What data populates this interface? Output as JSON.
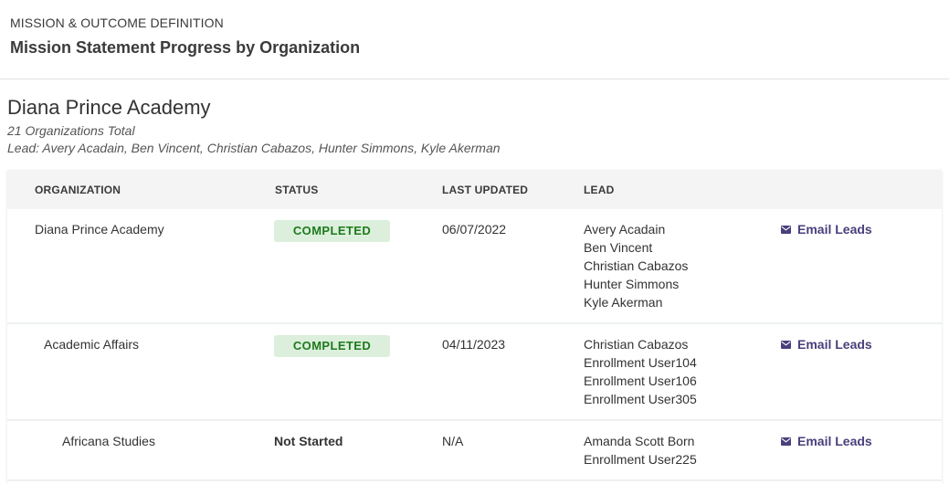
{
  "header": {
    "eyebrow": "MISSION & OUTCOME DEFINITION",
    "title": "Mission Statement Progress by Organization"
  },
  "organization": {
    "name": "Diana Prince Academy",
    "total": "21 Organizations Total",
    "leads": "Lead: Avery Acadain, Ben Vincent, Christian Cabazos, Hunter Simmons, Kyle Akerman"
  },
  "table": {
    "columns": [
      "ORGANIZATION",
      "STATUS",
      "LAST UPDATED",
      "LEAD"
    ],
    "rows": [
      {
        "organization": "Diana Prince Academy",
        "status": "COMPLETED",
        "last_updated": "06/07/2022",
        "leads": [
          "Avery Acadain",
          "Ben Vincent",
          "Christian Cabazos",
          "Hunter Simmons",
          "Kyle Akerman"
        ],
        "action": "Email Leads"
      },
      {
        "organization": "Academic Affairs",
        "status": "COMPLETED",
        "last_updated": "04/11/2023",
        "leads": [
          "Christian Cabazos",
          "Enrollment User104",
          "Enrollment User106",
          "Enrollment User305"
        ],
        "action": "Email Leads"
      },
      {
        "organization": "Africana Studies",
        "status": "Not Started",
        "last_updated": "N/A",
        "leads": [
          "Amanda Scott Born",
          "Enrollment User225"
        ],
        "action": "Email Leads"
      }
    ]
  },
  "colors": {
    "completed_badge_bg": "#dcefdc",
    "completed_badge_text": "#1e7a1e",
    "link": "#4a3f7c"
  },
  "icons": {
    "email": "envelope-icon"
  }
}
